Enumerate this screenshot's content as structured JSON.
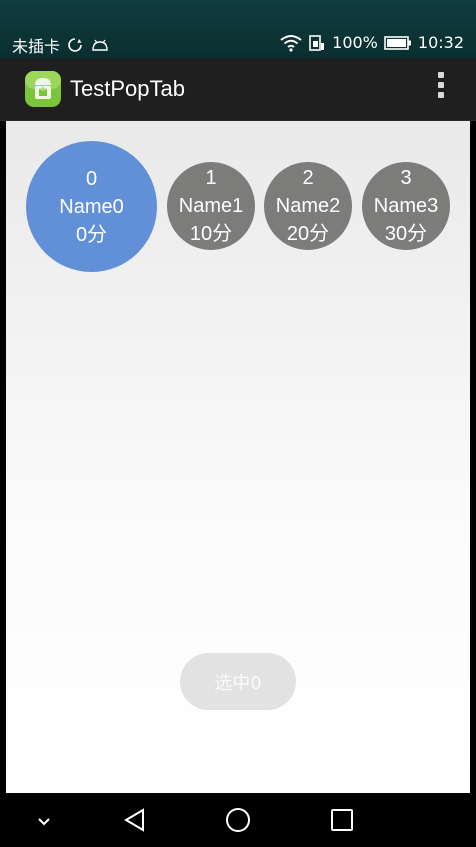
{
  "status_bar": {
    "carrier": "未插卡",
    "battery": "100%",
    "time": "10:32"
  },
  "action_bar": {
    "title": "TestPopTab"
  },
  "tabs": [
    {
      "index": "0",
      "name": "Name0",
      "score": "0分",
      "selected": true
    },
    {
      "index": "1",
      "name": "Name1",
      "score": "10分",
      "selected": false
    },
    {
      "index": "2",
      "name": "Name2",
      "score": "20分",
      "selected": false
    },
    {
      "index": "3",
      "name": "Name3",
      "score": "30分",
      "selected": false
    }
  ],
  "selected_button": {
    "label": "选中0"
  },
  "colors": {
    "selected_tab": "#6190d8",
    "unselected_tab": "#7c7c7b",
    "status_bar": "#0f3c3d",
    "action_bar": "#1f1f1f"
  }
}
